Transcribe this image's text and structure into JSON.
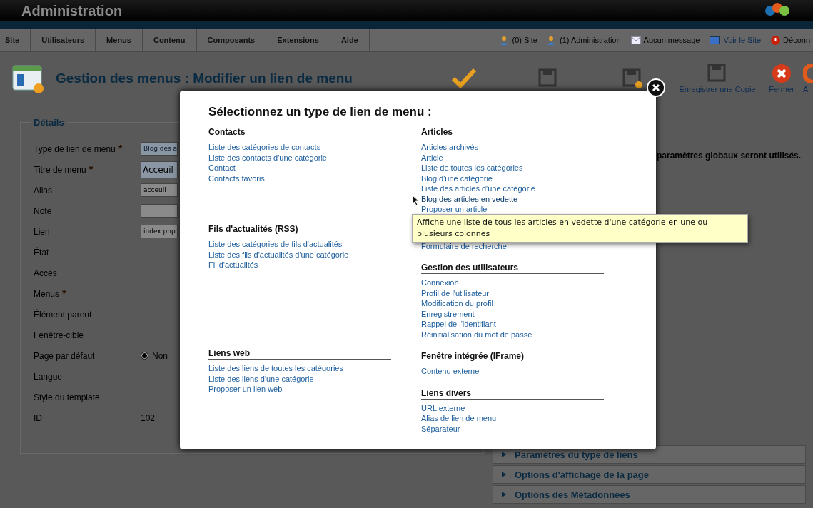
{
  "header": {
    "title": "Administration"
  },
  "menu": {
    "items": [
      {
        "label": "Site"
      },
      {
        "label": "Utilisateurs"
      },
      {
        "label": "Menus"
      },
      {
        "label": "Contenu"
      },
      {
        "label": "Composants"
      },
      {
        "label": "Extensions"
      },
      {
        "label": "Aide"
      }
    ],
    "status": [
      {
        "kind": "users",
        "label": "(0) Site"
      },
      {
        "kind": "users",
        "label": "(1) Administration"
      },
      {
        "kind": "mail",
        "label": "Aucun message"
      },
      {
        "kind": "screen",
        "label": "Voir le Site"
      },
      {
        "kind": "logout",
        "label": "Déconn"
      }
    ]
  },
  "toolbar": {
    "title": "Gestion des menus : Modifier un lien de menu",
    "buttons": [
      {
        "kind": "check"
      },
      {
        "kind": "save"
      },
      {
        "kind": "save-new"
      },
      {
        "kind": "save-copy",
        "label": "Enregistrer une Copie"
      },
      {
        "kind": "close",
        "label": "Fermer"
      },
      {
        "kind": "help",
        "label": "A"
      }
    ]
  },
  "details": {
    "legend": "Détails",
    "rows": [
      {
        "label": "Type de lien de menu",
        "required_mark": "*",
        "kind": "select",
        "value": "Blog des a"
      },
      {
        "label": "Titre de menu",
        "required_mark": "*",
        "kind": "title",
        "value": "Acceuil"
      },
      {
        "label": "Alias",
        "kind": "input",
        "value": "acceuil"
      },
      {
        "label": "Note",
        "kind": "input",
        "value": ""
      },
      {
        "label": "Lien",
        "kind": "input",
        "value": "index.php"
      },
      {
        "label": "État",
        "kind": "none"
      },
      {
        "label": "Accès",
        "kind": "none"
      },
      {
        "label": "Menus",
        "required_mark": "*",
        "kind": "none"
      },
      {
        "label": "Élément parent",
        "kind": "none"
      },
      {
        "label": "Fenêtre-cible",
        "kind": "none"
      },
      {
        "label": "Page par défaut",
        "kind": "radio",
        "value": "Non",
        "checked": true
      },
      {
        "label": "Langue",
        "kind": "none"
      },
      {
        "label": "Style du template",
        "kind": "none"
      },
      {
        "label": "ID",
        "kind": "text",
        "value": "102"
      }
    ]
  },
  "right_panel": {
    "note": "paramètres globaux seront utilisés.",
    "sliders": [
      "Paramètres du type de liens",
      "Options d'affichage de la page",
      "Options des Métadonnées"
    ]
  },
  "modal": {
    "title": "Sélectionnez un type de lien de menu :",
    "columns": [
      [
        {
          "heading": "Contacts",
          "items": [
            {
              "label": "Liste des catégories de contacts",
              "hovered": false
            },
            {
              "label": "Liste des contacts d'une catégorie",
              "hovered": false
            },
            {
              "label": "Contact",
              "hovered": false
            },
            {
              "label": "Contacts favoris",
              "hovered": false
            }
          ]
        },
        {
          "heading": "Fils d'actualités (RSS)",
          "items": [
            {
              "label": "Liste des catégories de fils d'actualités",
              "hovered": false
            },
            {
              "label": "Liste des fils d'actualités d'une catégorie",
              "hovered": false
            },
            {
              "label": "Fil d'actualités",
              "hovered": false
            }
          ]
        },
        {
          "heading": "Liens web",
          "items": [
            {
              "label": "Liste des liens de toutes les catégories",
              "hovered": false
            },
            {
              "label": "Liste des liens d'une catégorie",
              "hovered": false
            },
            {
              "label": "Proposer un lien web",
              "hovered": false
            }
          ]
        }
      ],
      [
        {
          "heading": "Articles",
          "items": [
            {
              "label": "Articles archivés",
              "hovered": false
            },
            {
              "label": "Article",
              "hovered": false
            },
            {
              "label": "Liste de toutes les catégories",
              "hovered": false
            },
            {
              "label": "Blog d'une catégorie",
              "hovered": false
            },
            {
              "label": "Liste des articles d'une catégorie",
              "hovered": false
            },
            {
              "label": "Blog des articles en vedette",
              "hovered": true
            },
            {
              "label": "Proposer un article",
              "hovered": false
            }
          ]
        },
        {
          "items": [
            {
              "label": "Formulaire de recherche",
              "hovered": false
            }
          ]
        },
        {
          "heading": "Gestion des utilisateurs",
          "items": [
            {
              "label": "Connexion",
              "hovered": false
            },
            {
              "label": "Profil de l'utilisateur",
              "hovered": false
            },
            {
              "label": "Modification du profil",
              "hovered": false
            },
            {
              "label": "Enregistrement",
              "hovered": false
            },
            {
              "label": "Rappel de l'identifiant",
              "hovered": false
            },
            {
              "label": "Réinitialisation du mot de passe",
              "hovered": false
            }
          ]
        },
        {
          "heading": "Fenêtre intégrée (IFrame)",
          "items": [
            {
              "label": "Contenu externe",
              "hovered": false
            }
          ]
        },
        {
          "heading": "Liens divers",
          "items": [
            {
              "label": "URL externe",
              "hovered": false
            },
            {
              "label": "Alias de lien de menu",
              "hovered": false
            },
            {
              "label": "Séparateur",
              "hovered": false
            }
          ]
        }
      ]
    ],
    "tooltip": "Affiche une liste de tous les articles en vedette d'une catégorie en une ou plusieurs colonnes"
  }
}
